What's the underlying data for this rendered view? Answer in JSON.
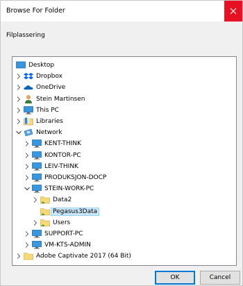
{
  "window": {
    "title": "Browse For Folder",
    "close_icon": "close-icon"
  },
  "description": "Filplassering",
  "tree": {
    "items": [
      {
        "label": "Desktop",
        "icon": "desktop-icon",
        "level": 0,
        "chevron": "none"
      },
      {
        "label": "Dropbox",
        "icon": "dropbox-icon",
        "level": 1,
        "chevron": "right"
      },
      {
        "label": "OneDrive",
        "icon": "onedrive-icon",
        "level": 1,
        "chevron": "right"
      },
      {
        "label": "Stein Martinsen",
        "icon": "user-icon",
        "level": 1,
        "chevron": "right"
      },
      {
        "label": "This PC",
        "icon": "computer-icon",
        "level": 1,
        "chevron": "right"
      },
      {
        "label": "Libraries",
        "icon": "libraries-icon",
        "level": 1,
        "chevron": "right"
      },
      {
        "label": "Network",
        "icon": "network-icon",
        "level": 1,
        "chevron": "down"
      },
      {
        "label": "KENT-THINK",
        "icon": "computer-icon",
        "level": 2,
        "chevron": "right"
      },
      {
        "label": "KONTOR-PC",
        "icon": "computer-icon",
        "level": 2,
        "chevron": "right"
      },
      {
        "label": "LEIV-THINK",
        "icon": "computer-icon",
        "level": 2,
        "chevron": "right"
      },
      {
        "label": "PRODUKSJON-DOCP",
        "icon": "computer-icon",
        "level": 2,
        "chevron": "right"
      },
      {
        "label": "STEIN-WORK-PC",
        "icon": "computer-icon",
        "level": 2,
        "chevron": "down"
      },
      {
        "label": "Data2",
        "icon": "shared-folder-icon",
        "level": 3,
        "chevron": "right"
      },
      {
        "label": "Pegasus3Data",
        "icon": "shared-folder-icon",
        "level": 3,
        "chevron": "none",
        "selected": true
      },
      {
        "label": "Users",
        "icon": "shared-folder-icon",
        "level": 3,
        "chevron": "right"
      },
      {
        "label": "SUPPORT-PC",
        "icon": "computer-icon",
        "level": 2,
        "chevron": "right"
      },
      {
        "label": "VM-KTS-ADMIN",
        "icon": "computer-icon",
        "level": 2,
        "chevron": "right"
      },
      {
        "label": "Adobe Captivate 2017 (64 Bit)",
        "icon": "folder-icon",
        "level": 1,
        "chevron": "right"
      }
    ]
  },
  "buttons": {
    "ok": "OK",
    "cancel": "Cancel"
  },
  "colors": {
    "close_button": "#e81123",
    "selection": "#cce8ff",
    "ok_border": "#0078d7",
    "folder": "#f8d775",
    "monitor": "#3a96dd"
  }
}
